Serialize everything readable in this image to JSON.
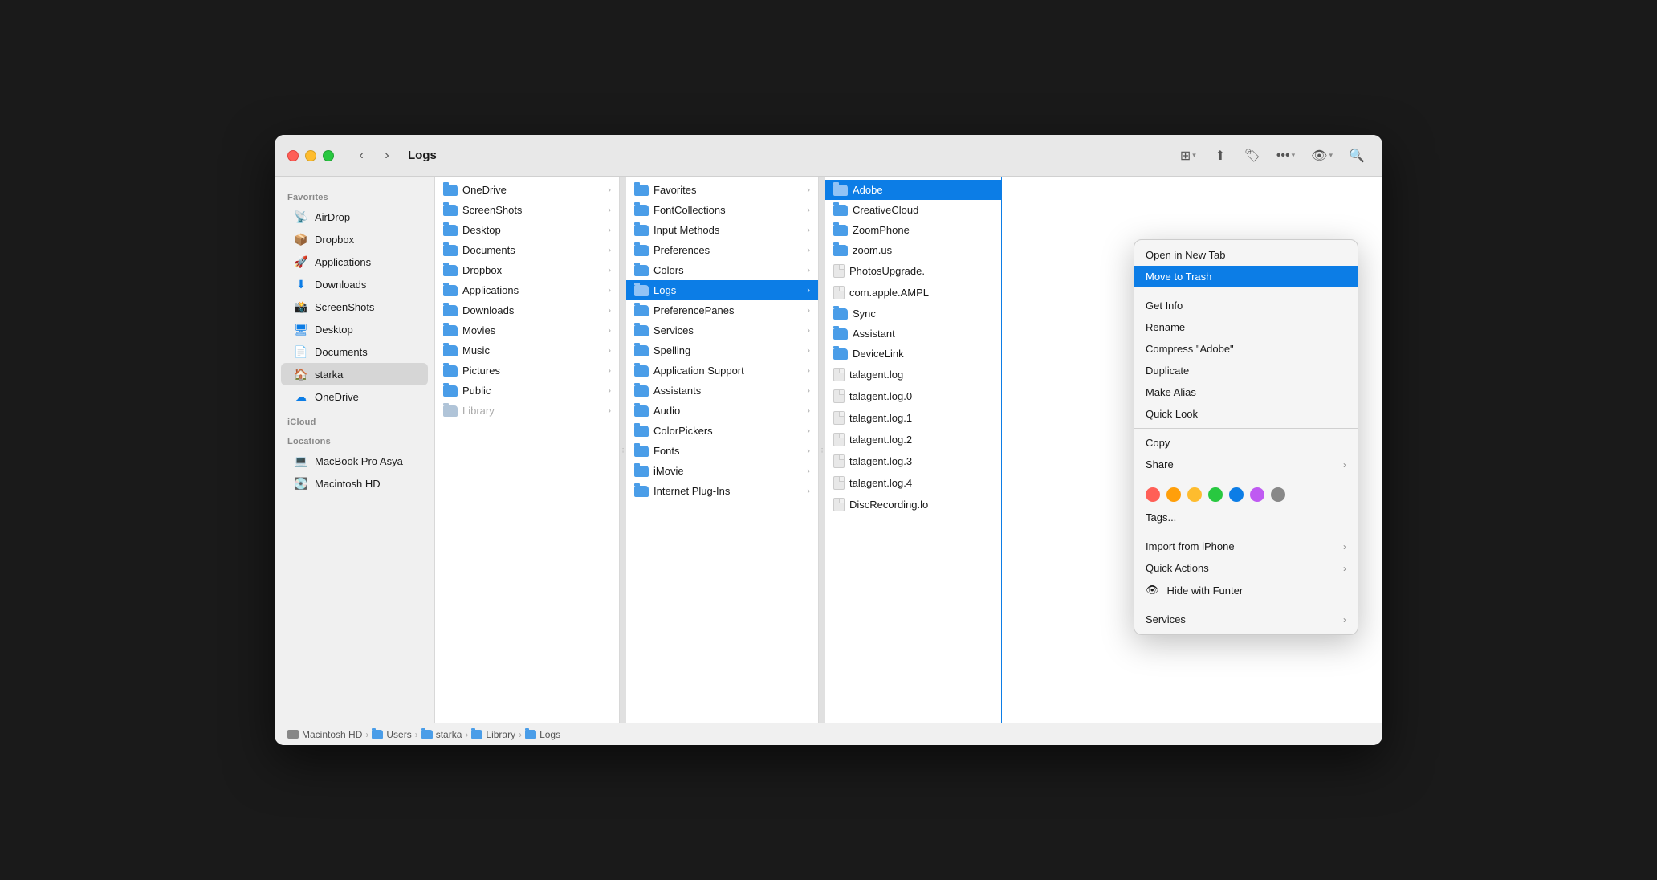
{
  "window": {
    "title": "Logs"
  },
  "titlebar": {
    "back_label": "‹",
    "forward_label": "›",
    "title": "Logs"
  },
  "sidebar": {
    "favorites_label": "Favorites",
    "icloud_label": "iCloud",
    "locations_label": "Locations",
    "items": [
      {
        "id": "airdrop",
        "label": "AirDrop",
        "icon": "📡",
        "active": false
      },
      {
        "id": "dropbox",
        "label": "Dropbox",
        "icon": "📦",
        "active": false
      },
      {
        "id": "applications",
        "label": "Applications",
        "icon": "🚀",
        "active": false
      },
      {
        "id": "downloads",
        "label": "Downloads",
        "icon": "⬇",
        "active": false
      },
      {
        "id": "screenshots",
        "label": "ScreenShots",
        "icon": "📸",
        "active": false
      },
      {
        "id": "desktop",
        "label": "Desktop",
        "icon": "🖥",
        "active": false
      },
      {
        "id": "documents",
        "label": "Documents",
        "icon": "📄",
        "active": false
      },
      {
        "id": "starka",
        "label": "starka",
        "icon": "🏠",
        "active": true
      },
      {
        "id": "onedrive",
        "label": "OneDrive",
        "icon": "☁",
        "active": false
      }
    ],
    "location_items": [
      {
        "id": "macbook",
        "label": "MacBook Pro Asya",
        "icon": "💻"
      },
      {
        "id": "macintosh",
        "label": "Macintosh HD",
        "icon": "💽"
      }
    ]
  },
  "col1": {
    "items": [
      {
        "label": "OneDrive",
        "type": "folder",
        "has_arrow": true
      },
      {
        "label": "ScreenShots",
        "type": "folder",
        "has_arrow": true
      },
      {
        "label": "Desktop",
        "type": "folder",
        "has_arrow": true
      },
      {
        "label": "Documents",
        "type": "folder",
        "has_arrow": true
      },
      {
        "label": "Dropbox",
        "type": "folder",
        "has_arrow": true
      },
      {
        "label": "Applications",
        "type": "folder",
        "has_arrow": true
      },
      {
        "label": "Downloads",
        "type": "folder",
        "has_arrow": true
      },
      {
        "label": "Movies",
        "type": "folder",
        "has_arrow": true
      },
      {
        "label": "Music",
        "type": "folder",
        "has_arrow": true
      },
      {
        "label": "Pictures",
        "type": "folder",
        "has_arrow": true
      },
      {
        "label": "Public",
        "type": "folder",
        "has_arrow": true
      },
      {
        "label": "Library",
        "type": "folder-dim",
        "has_arrow": true
      }
    ]
  },
  "col2": {
    "items": [
      {
        "label": "Favorites",
        "type": "folder",
        "has_arrow": true
      },
      {
        "label": "FontCollections",
        "type": "folder",
        "has_arrow": true
      },
      {
        "label": "Input Methods",
        "type": "folder",
        "has_arrow": true
      },
      {
        "label": "Preferences",
        "type": "folder",
        "has_arrow": true
      },
      {
        "label": "Colors",
        "type": "folder",
        "has_arrow": true
      },
      {
        "label": "Logs",
        "type": "folder",
        "has_arrow": true,
        "selected": true
      },
      {
        "label": "PreferencePanes",
        "type": "folder",
        "has_arrow": true
      },
      {
        "label": "Services",
        "type": "folder",
        "has_arrow": true
      },
      {
        "label": "Spelling",
        "type": "folder",
        "has_arrow": true
      },
      {
        "label": "Application Support",
        "type": "folder",
        "has_arrow": true
      },
      {
        "label": "Assistants",
        "type": "folder",
        "has_arrow": true
      },
      {
        "label": "Audio",
        "type": "folder",
        "has_arrow": true
      },
      {
        "label": "ColorPickers",
        "type": "folder",
        "has_arrow": true
      },
      {
        "label": "Fonts",
        "type": "folder",
        "has_arrow": true
      },
      {
        "label": "iMovie",
        "type": "folder",
        "has_arrow": true
      },
      {
        "label": "Internet Plug-Ins",
        "type": "folder",
        "has_arrow": true
      }
    ]
  },
  "col3": {
    "items": [
      {
        "label": "Adobe",
        "type": "folder",
        "has_arrow": false,
        "selected": true
      },
      {
        "label": "CreativeCloud",
        "type": "folder",
        "has_arrow": false
      },
      {
        "label": "ZoomPhone",
        "type": "folder",
        "has_arrow": false
      },
      {
        "label": "zoom.us",
        "type": "folder",
        "has_arrow": false
      },
      {
        "label": "PhotosUpgrade.",
        "type": "file",
        "has_arrow": false
      },
      {
        "label": "com.apple.AMPL",
        "type": "file",
        "has_arrow": false
      },
      {
        "label": "Sync",
        "type": "folder",
        "has_arrow": false
      },
      {
        "label": "Assistant",
        "type": "folder",
        "has_arrow": false
      },
      {
        "label": "DeviceLink",
        "type": "folder",
        "has_arrow": false
      },
      {
        "label": "talagent.log",
        "type": "file",
        "has_arrow": false
      },
      {
        "label": "talagent.log.0",
        "type": "file",
        "has_arrow": false
      },
      {
        "label": "talagent.log.1",
        "type": "file",
        "has_arrow": false
      },
      {
        "label": "talagent.log.2",
        "type": "file",
        "has_arrow": false
      },
      {
        "label": "talagent.log.3",
        "type": "file",
        "has_arrow": false
      },
      {
        "label": "talagent.log.4",
        "type": "file",
        "has_arrow": false
      },
      {
        "label": "DiscRecording.lo",
        "type": "file",
        "has_arrow": false
      }
    ]
  },
  "context_menu": {
    "items": [
      {
        "id": "open-new-tab",
        "label": "Open in New Tab",
        "has_arrow": false
      },
      {
        "id": "move-to-trash",
        "label": "Move to Trash",
        "selected": true,
        "has_arrow": false
      },
      {
        "id": "get-info",
        "label": "Get Info",
        "has_arrow": false
      },
      {
        "id": "rename",
        "label": "Rename",
        "has_arrow": false
      },
      {
        "id": "compress",
        "label": "Compress \"Adobe\"",
        "has_arrow": false
      },
      {
        "id": "duplicate",
        "label": "Duplicate",
        "has_arrow": false
      },
      {
        "id": "make-alias",
        "label": "Make Alias",
        "has_arrow": false
      },
      {
        "id": "quick-look",
        "label": "Quick Look",
        "has_arrow": false
      },
      {
        "id": "copy",
        "label": "Copy",
        "has_arrow": false
      },
      {
        "id": "share",
        "label": "Share",
        "has_arrow": true
      },
      {
        "id": "tags",
        "label": "Tags...",
        "has_arrow": false
      },
      {
        "id": "import-from-iphone",
        "label": "Import from iPhone",
        "has_arrow": true
      },
      {
        "id": "quick-actions",
        "label": "Quick Actions",
        "has_arrow": true
      },
      {
        "id": "hide-with-funter",
        "label": "Hide with Funter",
        "has_arrow": false
      },
      {
        "id": "services",
        "label": "Services",
        "has_arrow": true
      }
    ],
    "tags": [
      {
        "color": "#ff5f57"
      },
      {
        "color": "#ff9f0a"
      },
      {
        "color": "#febc2e"
      },
      {
        "color": "#28c840"
      },
      {
        "color": "#0c7de6"
      },
      {
        "color": "#bf5af2"
      },
      {
        "color": "#888888"
      }
    ]
  },
  "statusbar": {
    "path": [
      {
        "label": "Macintosh HD",
        "type": "hd"
      },
      {
        "label": "Users",
        "type": "folder"
      },
      {
        "label": "starka",
        "type": "folder"
      },
      {
        "label": "Library",
        "type": "folder"
      },
      {
        "label": "Logs",
        "type": "folder"
      }
    ]
  }
}
